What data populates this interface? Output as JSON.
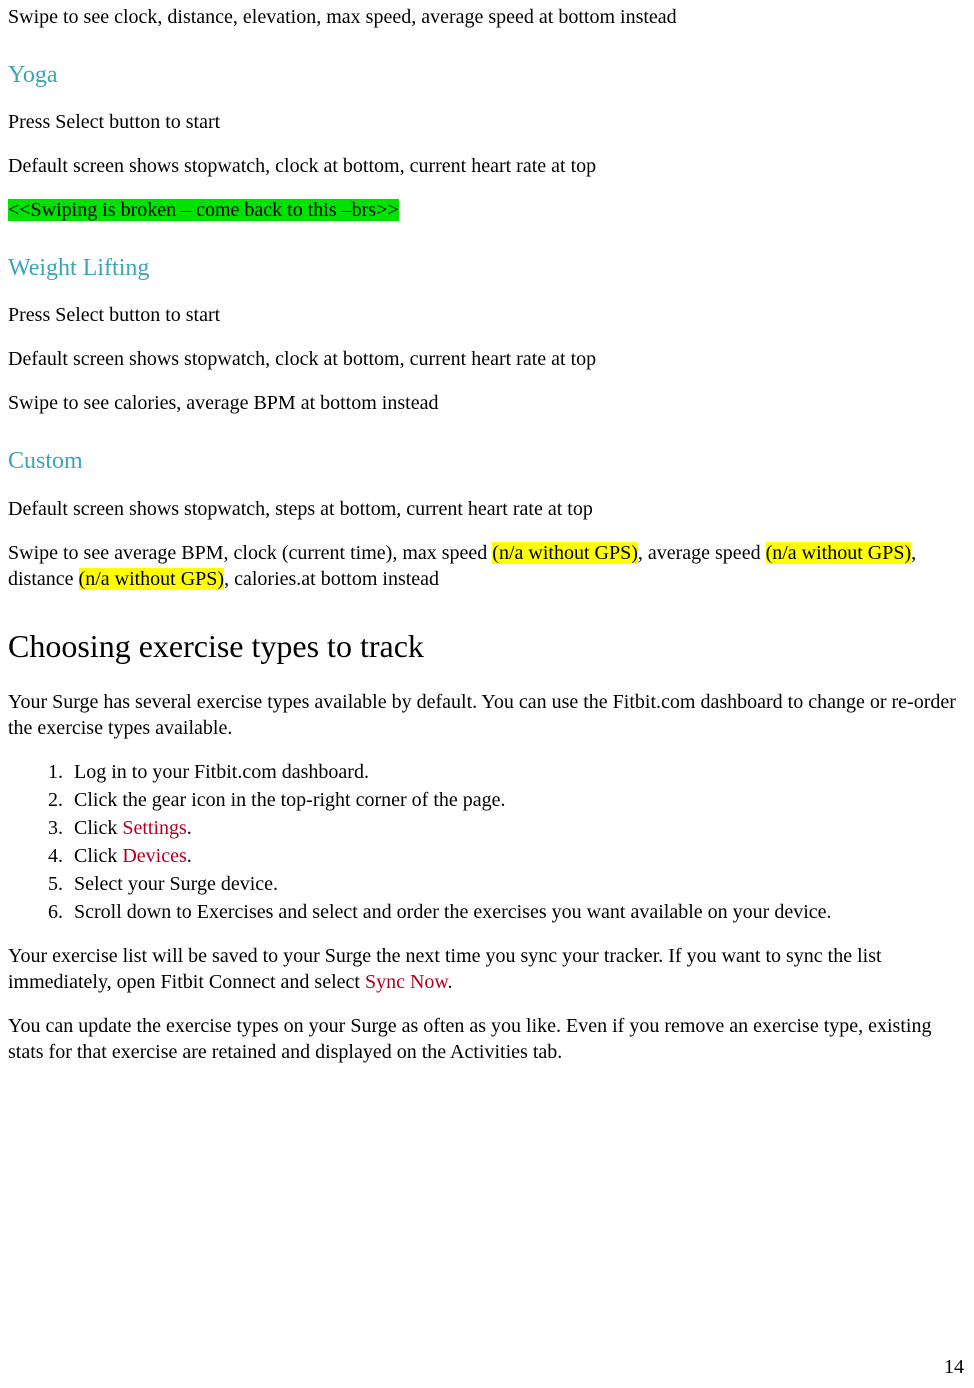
{
  "intro": "Swipe to see clock, distance, elevation, max speed, average speed at bottom instead",
  "yoga": {
    "heading": "Yoga",
    "p1": "Press Select button to start",
    "p2": "Default screen shows stopwatch, clock at bottom, current heart rate at top",
    "note": "<<Swiping is broken – come back to this –brs>>"
  },
  "weight": {
    "heading": "Weight Lifting",
    "p1": "Press Select button to start",
    "p2": "Default screen shows stopwatch, clock at bottom, current heart rate at top",
    "p3": "Swipe to see calories, average BPM at bottom instead"
  },
  "custom": {
    "heading": "Custom",
    "p1": "Default screen shows stopwatch, steps at bottom, current heart rate at top",
    "p2_a": "Swipe to see average BPM, clock (current time), max speed ",
    "p2_hl1": "(n/a without GPS)",
    "p2_b": ", average speed ",
    "p2_hl2": "(n/a without GPS)",
    "p2_c": ", distance ",
    "p2_hl3": "(n/a without GPS)",
    "p2_d": ", calories.at bottom instead"
  },
  "choosing": {
    "heading": "Choosing exercise types to track",
    "intro": "Your Surge has several exercise types available by default. You can use the Fitbit.com dashboard to change or re-order the exercise types available.",
    "li1": "Log in to your Fitbit.com dashboard.",
    "li2_a": "Click the ",
    "li2_gear": "gear",
    "li2_b": " icon in the top-right corner of the page.",
    "li3_a": "Click ",
    "li3_ui": "Settings",
    "li3_b": ".",
    "li4_a": "Click ",
    "li4_ui": "Devices",
    "li4_b": ".",
    "li5": "Select your Surge device.",
    "li6": "Scroll down to Exercises and select and order the exercises you want available on your device.",
    "after1_a": "Your exercise list will be saved to your Surge the next time you sync your tracker. If you want to sync the list immediately, open Fitbit Connect and select ",
    "after1_ui": "Sync Now",
    "after1_b": ".",
    "after2": "You can update the exercise types on your Surge as often as you like. Even if you remove an exercise type, existing stats for that exercise are retained and displayed on the Activities tab."
  },
  "page_number": "14"
}
